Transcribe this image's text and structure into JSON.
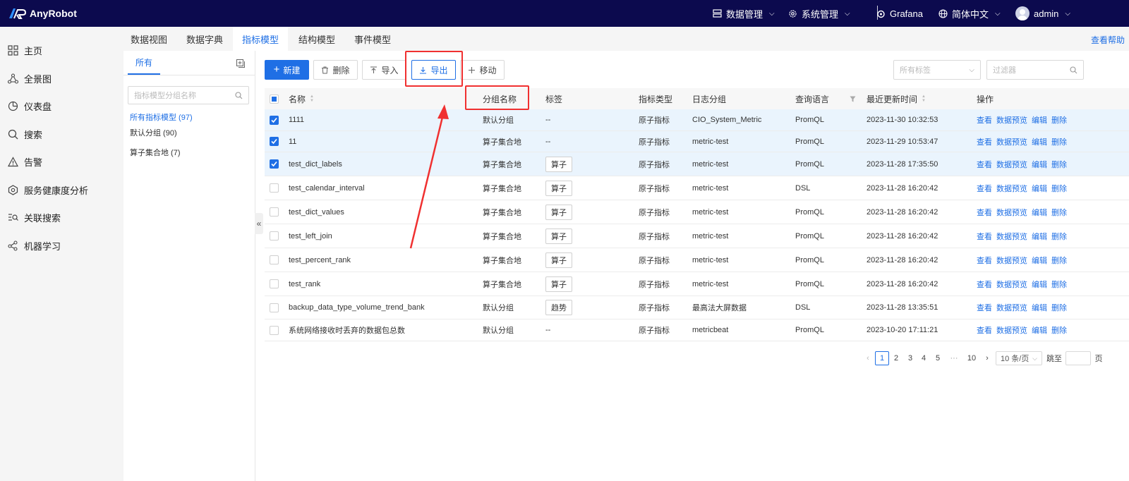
{
  "app": {
    "name": "AnyRobot"
  },
  "topbar": {
    "data_mgmt": "数据管理",
    "sys_mgmt": "系统管理",
    "grafana": "Grafana",
    "language": "简体中文",
    "user": "admin"
  },
  "nav": [
    {
      "label": "主页",
      "icon": "grid-icon"
    },
    {
      "label": "全景图",
      "icon": "topology-icon"
    },
    {
      "label": "仪表盘",
      "icon": "dashboard-icon"
    },
    {
      "label": "搜索",
      "icon": "search-icon"
    },
    {
      "label": "告警",
      "icon": "warning-icon"
    },
    {
      "label": "服务健康度分析",
      "icon": "service-health-icon"
    },
    {
      "label": "关联搜索",
      "icon": "related-search-icon"
    },
    {
      "label": "机器学习",
      "icon": "machine-learning-icon"
    }
  ],
  "tabs": [
    "数据视图",
    "数据字典",
    "指标模型",
    "结构模型",
    "事件模型"
  ],
  "help_link": "查看帮助",
  "group_panel": {
    "tab": "所有",
    "search_placeholder": "指标模型分组名称",
    "items": [
      {
        "label": "所有指标模型 (97)",
        "active": true
      },
      {
        "label": "默认分组 (90)",
        "active": false
      },
      {
        "label": "算子集合地 (7)",
        "active": false
      }
    ]
  },
  "toolbar": {
    "new": "新建",
    "delete": "删除",
    "import": "导入",
    "export": "导出",
    "move": "移动",
    "tag_filter_placeholder": "所有标签",
    "filter_placeholder": "过滤器"
  },
  "table": {
    "headers": {
      "name": "名称",
      "group": "分组名称",
      "tag": "标签",
      "type": "指标类型",
      "log_group": "日志分组",
      "query_lang": "查询语言",
      "updated": "最近更新时间",
      "ops": "操作"
    },
    "op_labels": [
      "查看",
      "数据预览",
      "编辑",
      "删除"
    ],
    "rows": [
      {
        "name": "1111",
        "group": "默认分组",
        "tag": "--",
        "type": "原子指标",
        "log_group": "CIO_System_Metric",
        "query_lang": "PromQL",
        "updated": "2023-11-30 10:32:53",
        "checked": true
      },
      {
        "name": "11",
        "group": "算子集合地",
        "tag": "--",
        "type": "原子指标",
        "log_group": "metric-test",
        "query_lang": "PromQL",
        "updated": "2023-11-29 10:53:47",
        "checked": true
      },
      {
        "name": "test_dict_labels",
        "group": "算子集合地",
        "tag": "算子",
        "type": "原子指标",
        "log_group": "metric-test",
        "query_lang": "PromQL",
        "updated": "2023-11-28 17:35:50",
        "checked": true
      },
      {
        "name": "test_calendar_interval",
        "group": "算子集合地",
        "tag": "算子",
        "type": "原子指标",
        "log_group": "metric-test",
        "query_lang": "DSL",
        "updated": "2023-11-28 16:20:42",
        "checked": false
      },
      {
        "name": "test_dict_values",
        "group": "算子集合地",
        "tag": "算子",
        "type": "原子指标",
        "log_group": "metric-test",
        "query_lang": "PromQL",
        "updated": "2023-11-28 16:20:42",
        "checked": false
      },
      {
        "name": "test_left_join",
        "group": "算子集合地",
        "tag": "算子",
        "type": "原子指标",
        "log_group": "metric-test",
        "query_lang": "PromQL",
        "updated": "2023-11-28 16:20:42",
        "checked": false
      },
      {
        "name": "test_percent_rank",
        "group": "算子集合地",
        "tag": "算子",
        "type": "原子指标",
        "log_group": "metric-test",
        "query_lang": "PromQL",
        "updated": "2023-11-28 16:20:42",
        "checked": false
      },
      {
        "name": "test_rank",
        "group": "算子集合地",
        "tag": "算子",
        "type": "原子指标",
        "log_group": "metric-test",
        "query_lang": "PromQL",
        "updated": "2023-11-28 16:20:42",
        "checked": false
      },
      {
        "name": "backup_data_type_volume_trend_bank",
        "group": "默认分组",
        "tag": "趋势",
        "type": "原子指标",
        "log_group": "最高法大屏数据",
        "query_lang": "DSL",
        "updated": "2023-11-28 13:35:51",
        "checked": false
      },
      {
        "name": "系统网络接收时丢弃的数据包总数",
        "group": "默认分组",
        "tag": "--",
        "type": "原子指标",
        "log_group": "metricbeat",
        "query_lang": "PromQL",
        "updated": "2023-10-20 17:11:21",
        "checked": false
      }
    ]
  },
  "pagination": {
    "pages": [
      "1",
      "2",
      "3",
      "4",
      "5",
      "···",
      "10"
    ],
    "page_size": "10 条/页",
    "jump_label": "跳至",
    "page_suffix": "页"
  },
  "colors": {
    "accent": "#1f6fe5",
    "topbar": "#0c0a4e",
    "annotation": "#f03030"
  }
}
